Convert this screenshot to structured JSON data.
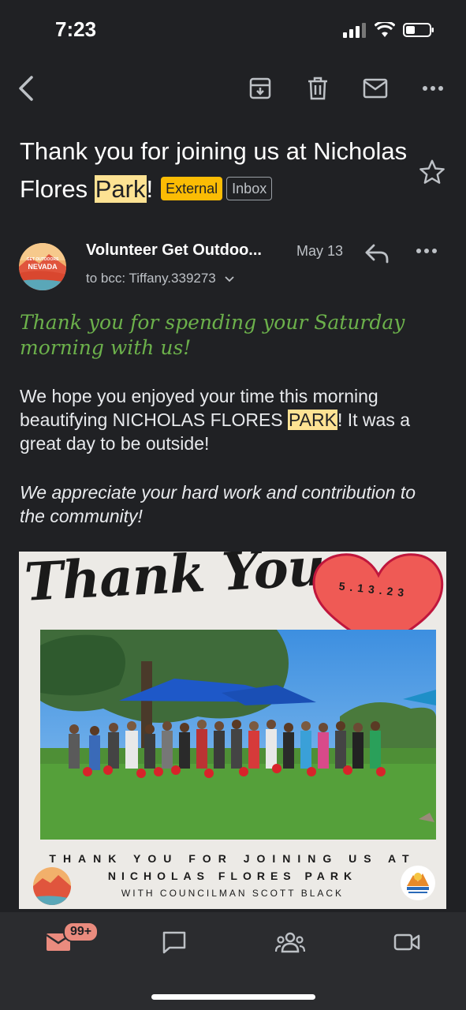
{
  "status": {
    "time": "7:23"
  },
  "email": {
    "subject_prefix": "Thank you for joining us at Nicholas Flores ",
    "subject_highlight": "Park",
    "subject_suffix": "!",
    "label_external": "External",
    "label_inbox": "Inbox",
    "sender": "Volunteer Get Outdoo...",
    "date": "May 13",
    "to_line": "to bcc: Tiffany.339273",
    "greeting": "Thank you for spending your Saturday morning with us!",
    "body_prefix": "We hope you enjoyed your time this morning beautifying NICHOLAS FLORES ",
    "body_highlight": "PARK",
    "body_suffix": "! It was a great day to be outside!",
    "body_italic": "We appreciate your hard work and contribution to the community!"
  },
  "flyer": {
    "title": "Thank You",
    "date": "5.13.23",
    "line1": "THANK YOU FOR JOINING US AT",
    "line2": "NICHOLAS FLORES PARK",
    "line3": "WITH COUNCILMAN SCOTT BLACK",
    "logo_text_top": "GET OUTDOORS",
    "logo_text": "NEVADA"
  },
  "nav": {
    "mail_badge": "99+"
  },
  "colors": {
    "external_chip": "#fbbc04",
    "highlight": "#fde293",
    "greeting": "#6cb14b",
    "badge": "#ea8b7e"
  },
  "icons": [
    "back-icon",
    "archive-icon",
    "trash-icon",
    "mail-icon",
    "more-icon",
    "star-icon",
    "reply-icon",
    "chevron-down-icon",
    "mail-nav-icon",
    "chat-icon",
    "spaces-icon",
    "meet-icon"
  ]
}
